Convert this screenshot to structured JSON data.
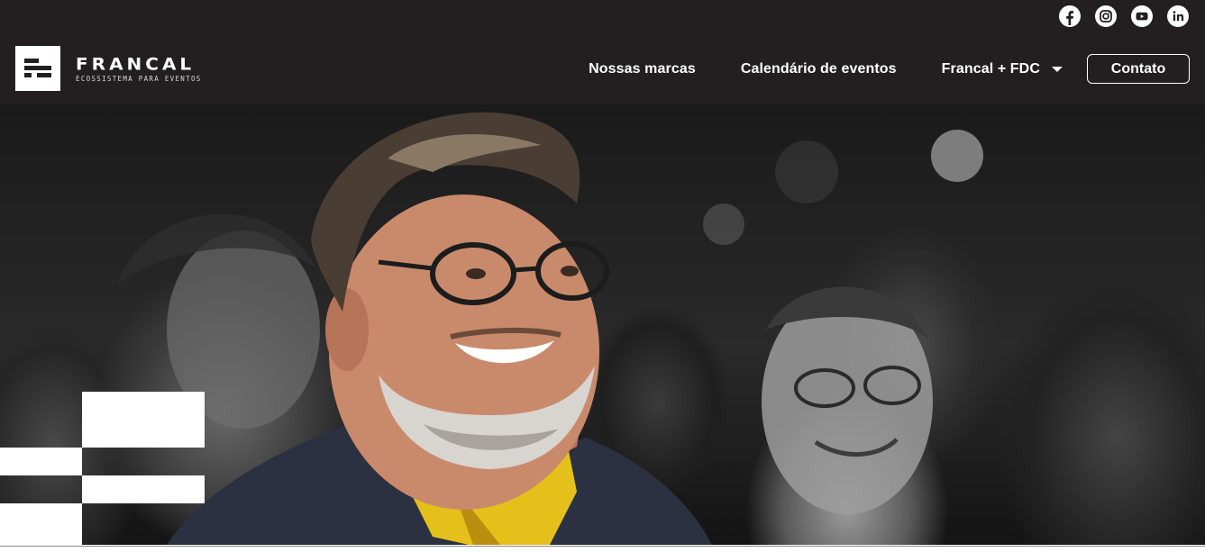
{
  "social": [
    {
      "name": "facebook-icon",
      "label": "Facebook"
    },
    {
      "name": "instagram-icon",
      "label": "Instagram"
    },
    {
      "name": "youtube-icon",
      "label": "YouTube"
    },
    {
      "name": "linkedin-icon",
      "label": "LinkedIn"
    }
  ],
  "brand": {
    "name": "FRANCAL",
    "tagline": "ECOSSISTEMA PARA EVENTOS"
  },
  "nav": {
    "items": [
      {
        "label": "Nossas marcas"
      },
      {
        "label": "Calendário de eventos"
      },
      {
        "label": "Francal + FDC",
        "has_dropdown": true
      }
    ],
    "cta": "Contato"
  },
  "hero": {
    "image": "smiling-man-with-glasses-in-audience"
  },
  "colors": {
    "header_bg": "#231f20",
    "text": "#ffffff",
    "accent_shirt": "#e5c01a"
  }
}
